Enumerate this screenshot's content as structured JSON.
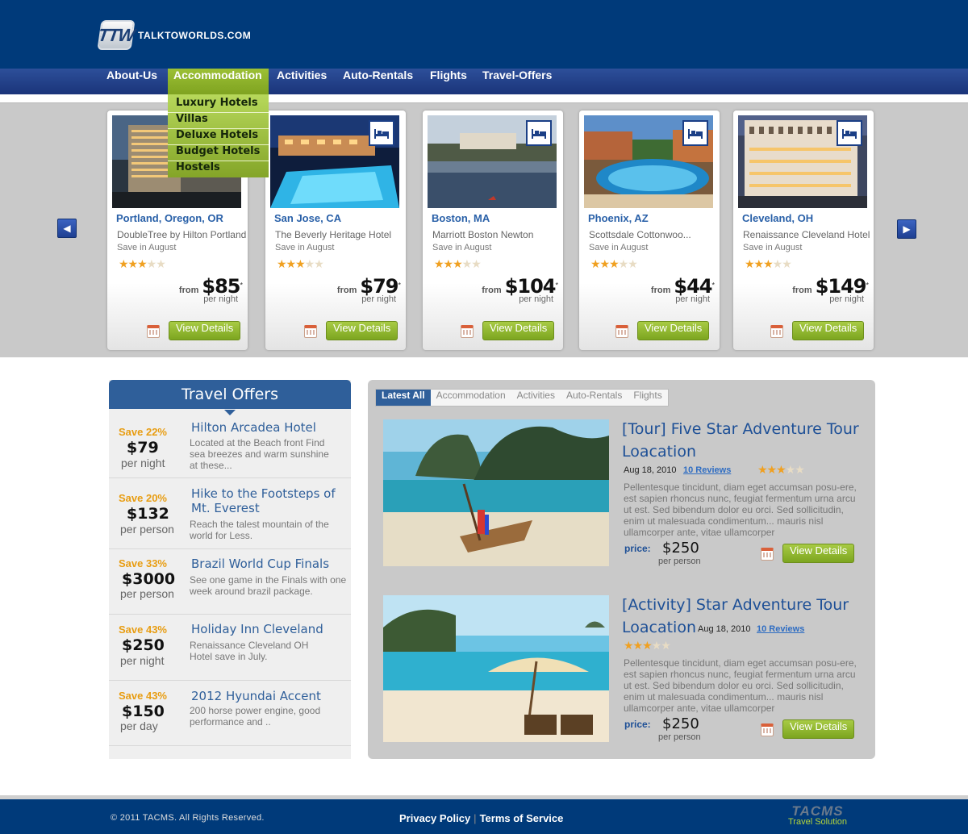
{
  "header": {
    "logo_mark": "TTW",
    "logo_text": "TALKTOWORLDS.COM"
  },
  "nav": {
    "items": [
      "About-Us",
      "Accommodation",
      "Activities",
      "Auto-Rentals",
      "Flights",
      "Travel-Offers"
    ],
    "active": "Accommodation",
    "dropdown": [
      "Luxury Hotels",
      "Villas",
      "Deluxe Hotels",
      "Budget Hotels",
      "Hostels"
    ]
  },
  "carousel": {
    "cards": [
      {
        "city": "Portland, Oregon, OR",
        "hotel": "DoubleTree by Hilton Portland",
        "save": "Save in August",
        "rating": 3,
        "from": "from",
        "price": "$85",
        "asterisk": "*",
        "per": "per night",
        "button": "View Details"
      },
      {
        "city": "San Jose, CA",
        "hotel": "The Beverly Heritage Hotel",
        "save": "Save in August",
        "rating": 3,
        "from": "from",
        "price": "$79",
        "asterisk": "*",
        "per": "per night",
        "button": "View Details"
      },
      {
        "city": "Boston, MA",
        "hotel": "Marriott Boston Newton",
        "save": "Save in August",
        "rating": 3,
        "from": "from",
        "price": "$104",
        "asterisk": "*",
        "per": "per night",
        "button": "View Details"
      },
      {
        "city": "Phoenix, AZ",
        "hotel": "Scottsdale Cottonwoo...",
        "save": "Save in August",
        "rating": 3,
        "from": "from",
        "price": "$44",
        "asterisk": "*",
        "per": "per night",
        "button": "View Details"
      },
      {
        "city": "Cleveland, OH",
        "hotel": "Renaissance Cleveland Hotel",
        "save": "Save in August",
        "rating": 3,
        "from": "from",
        "price": "$149",
        "asterisk": "*",
        "per": "per night",
        "button": "View Details"
      }
    ]
  },
  "offers": {
    "title": "Travel Offers",
    "items": [
      {
        "save": "Save 22%",
        "price": "$79",
        "unit": "per night",
        "title": "Hilton Arcadea Hotel",
        "desc": "Located at the Beach front Find sea breezes and warm sunshine at these..."
      },
      {
        "save": "Save 20%",
        "price": "$132",
        "unit": "per person",
        "title": "Hike to the Footsteps of Mt. Everest",
        "desc": "Reach the talest mountain of the world for Less."
      },
      {
        "save": "Save 33%",
        "price": "$3000",
        "unit": "per person",
        "title": "Brazil World Cup Finals",
        "desc": "See one game in the Finals with one week around brazil package."
      },
      {
        "save": "Save 43%",
        "price": "$250",
        "unit": "per night",
        "title": "Holiday Inn Cleveland",
        "desc": "Renaissance Cleveland OH Hotel save in July."
      },
      {
        "save": "Save 43%",
        "price": "$150",
        "unit": "per day",
        "title": "2012 Hyundai Accent",
        "desc": "200 horse power engine, good performance and .."
      }
    ]
  },
  "latest": {
    "tabs": [
      "Latest All",
      "Accommodation",
      "Activities",
      "Auto-Rentals",
      "Flights"
    ],
    "active_tab": "Latest All",
    "articles": [
      {
        "title": "[Tour] Five Star Adventure Tour Loacation",
        "date": "Aug 18, 2010",
        "reviews": "10 Reviews",
        "rating": 3,
        "body": "Pellentesque tincidunt, diam eget accumsan posu-ere, est sapien rhoncus nunc, feugiat fermentum urna arcu ut est. Sed bibendum dolor eu orci. Sed sollicitudin, enim ut malesuada condimentum... mauris nisl ullamcorper ante, vitae ullamcorper",
        "price_label": "price:",
        "price": "$250",
        "unit": "per person",
        "button": "View Details"
      },
      {
        "title": "[Activity] Star Adventure Tour Loacation",
        "date": "Aug 18, 2010",
        "reviews": "10 Reviews",
        "rating": 3,
        "body": "Pellentesque tincidunt, diam eget accumsan posu-ere, est sapien rhoncus nunc, feugiat fermentum urna arcu ut est. Sed bibendum dolor eu orci. Sed sollicitudin, enim ut malesuada condimentum... mauris nisl ullamcorper ante, vitae ullamcorper",
        "price_label": "price:",
        "price": "$250",
        "unit": "per person",
        "button": "View Details"
      }
    ]
  },
  "footer": {
    "copyright": "© 2011 TACMS. All Rights Reserved.",
    "links": [
      "Privacy Policy",
      "Terms of Service"
    ],
    "brand": "TACMS",
    "brand_sub": "Travel Solution"
  },
  "colors": {
    "navy": "#003a7a",
    "nav": "#1a347a",
    "green": "#8db52a",
    "link": "#2f5f9a",
    "orange": "#e89d12"
  }
}
